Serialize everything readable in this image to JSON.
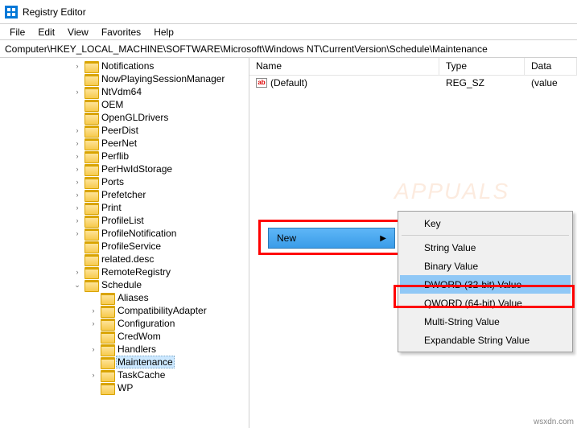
{
  "window": {
    "title": "Registry Editor"
  },
  "menubar": {
    "file": "File",
    "edit": "Edit",
    "view": "View",
    "favorites": "Favorites",
    "help": "Help"
  },
  "addressbar": {
    "path": "Computer\\HKEY_LOCAL_MACHINE\\SOFTWARE\\Microsoft\\Windows NT\\CurrentVersion\\Schedule\\Maintenance"
  },
  "tree": {
    "items": [
      {
        "depth": 1,
        "exp": ">",
        "label": "Notifications"
      },
      {
        "depth": 1,
        "exp": "",
        "label": "NowPlayingSessionManager"
      },
      {
        "depth": 1,
        "exp": ">",
        "label": "NtVdm64"
      },
      {
        "depth": 1,
        "exp": "",
        "label": "OEM"
      },
      {
        "depth": 1,
        "exp": "",
        "label": "OpenGLDrivers"
      },
      {
        "depth": 1,
        "exp": ">",
        "label": "PeerDist"
      },
      {
        "depth": 1,
        "exp": ">",
        "label": "PeerNet"
      },
      {
        "depth": 1,
        "exp": ">",
        "label": "Perflib"
      },
      {
        "depth": 1,
        "exp": ">",
        "label": "PerHwIdStorage"
      },
      {
        "depth": 1,
        "exp": ">",
        "label": "Ports"
      },
      {
        "depth": 1,
        "exp": ">",
        "label": "Prefetcher"
      },
      {
        "depth": 1,
        "exp": ">",
        "label": "Print"
      },
      {
        "depth": 1,
        "exp": ">",
        "label": "ProfileList"
      },
      {
        "depth": 1,
        "exp": ">",
        "label": "ProfileNotification"
      },
      {
        "depth": 1,
        "exp": "",
        "label": "ProfileService"
      },
      {
        "depth": 1,
        "exp": "",
        "label": "related.desc"
      },
      {
        "depth": 1,
        "exp": ">",
        "label": "RemoteRegistry"
      },
      {
        "depth": 1,
        "exp": "v",
        "label": "Schedule"
      },
      {
        "depth": 2,
        "exp": "",
        "label": "Aliases"
      },
      {
        "depth": 2,
        "exp": ">",
        "label": "CompatibilityAdapter"
      },
      {
        "depth": 2,
        "exp": ">",
        "label": "Configuration"
      },
      {
        "depth": 2,
        "exp": "",
        "label": "CredWom"
      },
      {
        "depth": 2,
        "exp": ">",
        "label": "Handlers"
      },
      {
        "depth": 2,
        "exp": "",
        "label": "Maintenance",
        "selected": true
      },
      {
        "depth": 2,
        "exp": ">",
        "label": "TaskCache"
      },
      {
        "depth": 2,
        "exp": "",
        "label": "WP"
      }
    ]
  },
  "list": {
    "headers": {
      "name": "Name",
      "type": "Type",
      "data": "Data"
    },
    "rows": [
      {
        "name": "(Default)",
        "type": "REG_SZ",
        "data": "(value"
      }
    ]
  },
  "context": {
    "new_label": "New",
    "submenu": {
      "key": "Key",
      "string": "String Value",
      "binary": "Binary Value",
      "dword": "DWORD (32-bit) Value",
      "qword": "QWORD (64-bit) Value",
      "multistring": "Multi-String Value",
      "expandable": "Expandable String Value"
    }
  },
  "watermark": "APPUALS",
  "attribution": "wsxdn.com"
}
